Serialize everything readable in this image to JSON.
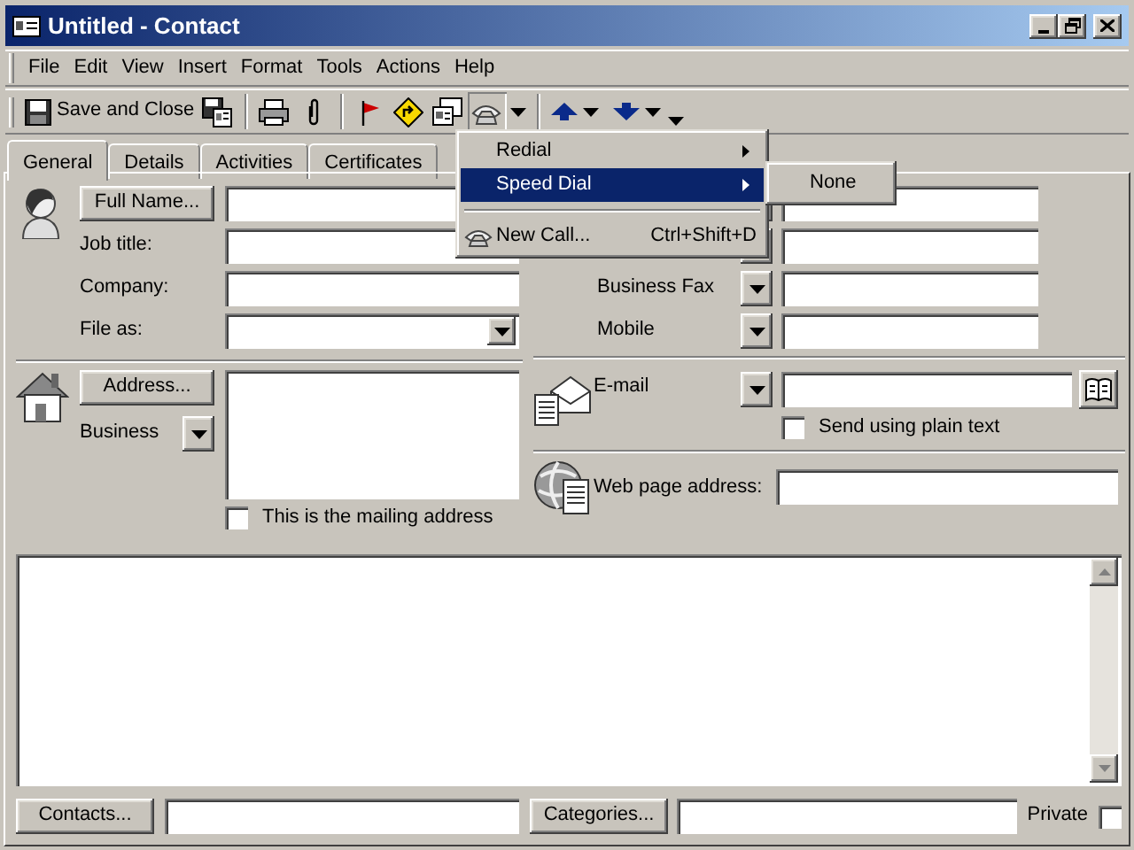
{
  "window": {
    "title": "Untitled - Contact"
  },
  "menu_bar": [
    {
      "label": "File"
    },
    {
      "label": "Edit"
    },
    {
      "label": "View"
    },
    {
      "label": "Insert"
    },
    {
      "label": "Format"
    },
    {
      "label": "Tools"
    },
    {
      "label": "Actions"
    },
    {
      "label": "Help"
    }
  ],
  "toolbar": {
    "save_close_label": "Save and Close",
    "dial_pressed": true
  },
  "tabs": [
    {
      "label": "General",
      "selected": true
    },
    {
      "label": "Details",
      "selected": false
    },
    {
      "label": "Activities",
      "selected": false
    },
    {
      "label": "Certificates",
      "selected": false
    }
  ],
  "name_section": {
    "full_name_button": "Full Name...",
    "fields": [
      {
        "label": "Job title:",
        "kind": "text"
      },
      {
        "label": "Company:",
        "kind": "text"
      },
      {
        "label": "File as:",
        "kind": "combo"
      }
    ]
  },
  "phone_rows": [
    {
      "kind": "covered"
    },
    {
      "kind": "covered"
    },
    {
      "kind": "labeled",
      "label": "Business Fax"
    },
    {
      "kind": "labeled",
      "label": "Mobile"
    }
  ],
  "address": {
    "button": "Address...",
    "type": "Business",
    "mailing_checkbox": {
      "label": "This is the mailing address",
      "checked": false
    }
  },
  "email": {
    "label": "E-mail",
    "plain_text_checkbox": {
      "label": "Send using plain text",
      "checked": false
    }
  },
  "web": {
    "label": "Web page address:"
  },
  "bottom": {
    "contacts_button": "Contacts...",
    "categories_button": "Categories...",
    "private": {
      "label": "Private",
      "checked": false
    }
  },
  "dial_menu": [
    {
      "kind": "submenu",
      "label": "Redial",
      "selected": false
    },
    {
      "kind": "submenu",
      "label": "Speed Dial",
      "selected": true
    },
    {
      "kind": "separator"
    },
    {
      "kind": "command",
      "label": "New Call...",
      "shortcut": "Ctrl+Shift+D",
      "selected": false
    }
  ],
  "speed_dial_submenu": [
    {
      "label": "None"
    }
  ]
}
